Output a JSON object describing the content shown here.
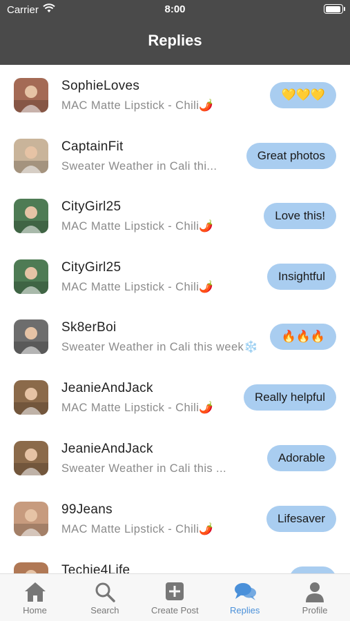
{
  "status_bar": {
    "carrier": "Carrier",
    "time": "8:00"
  },
  "header": {
    "title": "Replies"
  },
  "replies": [
    {
      "user": "SophieLoves",
      "post": "MAC Matte Lipstick - Chili🌶️",
      "reply": "💛💛💛",
      "avatar_color": "#a46a55"
    },
    {
      "user": "CaptainFit",
      "post": "Sweater Weather in Cali thi...",
      "reply": "Great photos",
      "avatar_color": "#c9b49a"
    },
    {
      "user": "CityGirl25",
      "post": "MAC Matte Lipstick - Chili🌶️",
      "reply": "Love this!",
      "avatar_color": "#4e7b54"
    },
    {
      "user": "CityGirl25",
      "post": "MAC Matte Lipstick - Chili🌶️",
      "reply": "Insightful",
      "avatar_color": "#4e7b54"
    },
    {
      "user": "Sk8erBoi",
      "post": "Sweater Weather in Cali this week❄️",
      "reply": "🔥🔥🔥",
      "avatar_color": "#6d6d6d"
    },
    {
      "user": "JeanieAndJack",
      "post": "MAC Matte Lipstick - Chili🌶️",
      "reply": "Really helpful",
      "avatar_color": "#8b6a4a"
    },
    {
      "user": "JeanieAndJack",
      "post": "Sweater Weather in Cali this ...",
      "reply": "Adorable",
      "avatar_color": "#8b6a4a"
    },
    {
      "user": "99Jeans",
      "post": "MAC Matte Lipstick - Chili🌶️",
      "reply": "Lifesaver",
      "avatar_color": "#c79b7e"
    },
    {
      "user": "Techie4Life",
      "post": "",
      "reply": "",
      "avatar_color": "#b07855"
    }
  ],
  "tabs": [
    {
      "label": "Home",
      "icon": "home-icon",
      "active": false
    },
    {
      "label": "Search",
      "icon": "search-icon",
      "active": false
    },
    {
      "label": "Create Post",
      "icon": "plus-square-icon",
      "active": false
    },
    {
      "label": "Replies",
      "icon": "chat-bubbles-icon",
      "active": true
    },
    {
      "label": "Profile",
      "icon": "person-icon",
      "active": false
    }
  ],
  "colors": {
    "header_bg": "#4a4a4a",
    "chip_bg": "#a9cdf0",
    "active_tab": "#4a90d9",
    "inactive_tab": "#777777"
  }
}
